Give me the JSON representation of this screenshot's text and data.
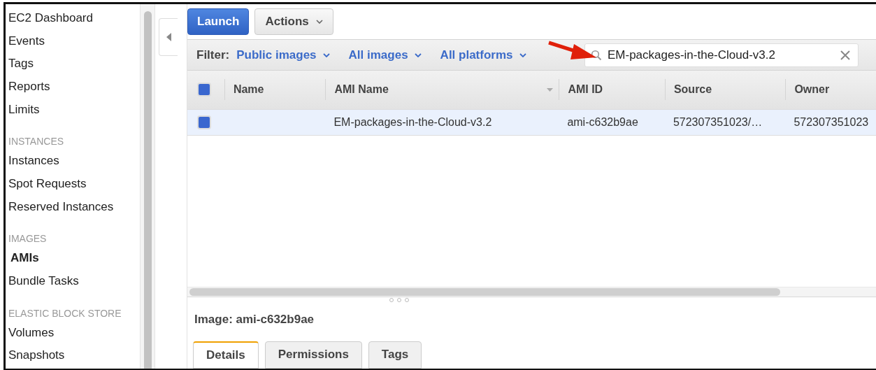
{
  "sidebar": {
    "items": [
      {
        "kind": "link",
        "label": "EC2 Dashboard",
        "selected": false
      },
      {
        "kind": "link",
        "label": "Events",
        "selected": false
      },
      {
        "kind": "link",
        "label": "Tags",
        "selected": false
      },
      {
        "kind": "link",
        "label": "Reports",
        "selected": false
      },
      {
        "kind": "link",
        "label": "Limits",
        "selected": false
      },
      {
        "kind": "header",
        "label": "INSTANCES"
      },
      {
        "kind": "link",
        "label": "Instances",
        "selected": false
      },
      {
        "kind": "link",
        "label": "Spot Requests",
        "selected": false
      },
      {
        "kind": "link",
        "label": "Reserved Instances",
        "selected": false
      },
      {
        "kind": "header",
        "label": "IMAGES"
      },
      {
        "kind": "link",
        "label": "AMIs",
        "selected": true
      },
      {
        "kind": "link",
        "label": "Bundle Tasks",
        "selected": false
      },
      {
        "kind": "header",
        "label": "ELASTIC BLOCK STORE"
      },
      {
        "kind": "link",
        "label": "Volumes",
        "selected": false
      },
      {
        "kind": "link",
        "label": "Snapshots",
        "selected": false
      }
    ]
  },
  "toolbar": {
    "launch_button": "Launch",
    "actions_button": "Actions"
  },
  "filter": {
    "label": "Filter:",
    "dropdowns": [
      "Public images",
      "All images",
      "All platforms"
    ],
    "search": {
      "value": "EM-packages-in-the-Cloud-v3.2"
    }
  },
  "table": {
    "select_all_checked": true,
    "columns": [
      {
        "label": "Name"
      },
      {
        "label": "AMI Name",
        "sortable": true
      },
      {
        "label": "AMI ID"
      },
      {
        "label": "Source"
      },
      {
        "label": "Owner"
      }
    ],
    "rows": [
      {
        "checked": true,
        "selected": true,
        "cells": [
          "",
          "EM-packages-in-the-Cloud-v3.2",
          "ami-c632b9ae",
          "572307351023/…",
          "572307351023"
        ]
      }
    ]
  },
  "details": {
    "title": "Image: ami-c632b9ae",
    "tabs": [
      {
        "label": "Details",
        "selected": true
      },
      {
        "label": "Permissions",
        "selected": false
      },
      {
        "label": "Tags",
        "selected": false
      }
    ]
  }
}
